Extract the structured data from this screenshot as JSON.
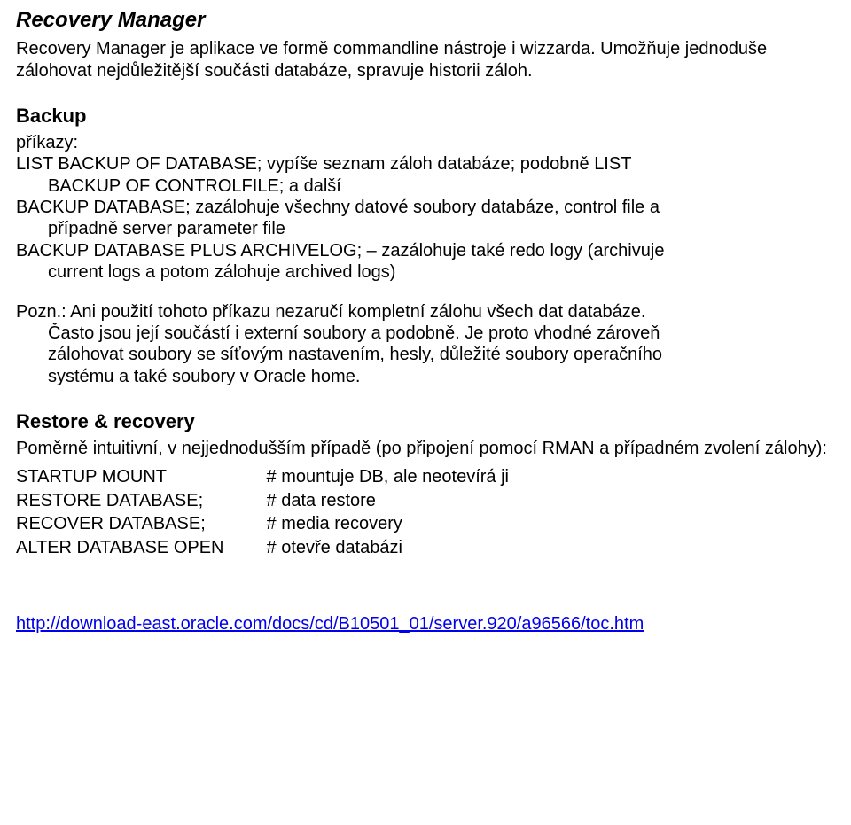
{
  "title": "Recovery Manager",
  "intro": "Recovery Manager je aplikace ve formě commandline nástroje i wizzarda. Umožňuje jednoduše zálohovat nejdůležitější součásti databáze, spravuje historii záloh.",
  "backup_heading": "Backup",
  "backup_prikazy": "příkazy:",
  "backup_line1a": "LIST BACKUP OF DATABASE; vypíše seznam záloh databáze; podobně LIST",
  "backup_line1b": "BACKUP OF CONTROLFILE; a další",
  "backup_line2a": "BACKUP DATABASE; zazálohuje všechny datové soubory databáze, control file a",
  "backup_line2b": "případně server parameter file",
  "backup_line3a": "BACKUP DATABASE PLUS ARCHIVELOG; – zazálohuje také redo logy (archivuje",
  "backup_line3b": "current logs a potom zálohuje archived logs)",
  "pozn_line1": "Pozn.: Ani použití tohoto příkazu nezaručí kompletní zálohu všech dat databáze.",
  "pozn_line2": "Často jsou její součástí i externí soubory a podobně. Je proto vhodné zároveň",
  "pozn_line3": "zálohovat soubory se síťovým nastavením, hesly, důležité soubory operačního",
  "pozn_line4": "systému a také soubory v Oracle home.",
  "restore_heading": "Restore & recovery",
  "restore_intro": "Poměrně intuitivní, v nejjednodušším případě (po připojení pomocí RMAN a případném zvolení zálohy):",
  "cmds": {
    "c1": "STARTUP MOUNT",
    "d1": "# mountuje DB, ale neotevírá ji",
    "c2": "RESTORE DATABASE;",
    "d2": "# data restore",
    "c3": "RECOVER DATABASE;",
    "d3": "# media recovery",
    "c4": "ALTER DATABASE OPEN",
    "d4": "# otevře databázi"
  },
  "link_text": "http://download-east.oracle.com/docs/cd/B10501_01/server.920/a96566/toc.htm",
  "link_href": "http://download-east.oracle.com/docs/cd/B10501_01/server.920/a96566/toc.htm"
}
